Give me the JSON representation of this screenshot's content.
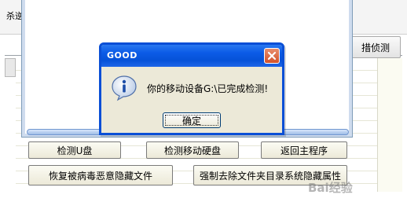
{
  "background": {
    "partial_title": "杀逆",
    "partial_tab_label": "措侦测"
  },
  "buttons": {
    "check_usb": "检测U盘",
    "check_hdd": "检测移动硬盘",
    "back_main": "返回主程序",
    "restore_hidden": "恢复被病毒恶意隐藏文件",
    "force_remove_hidden": "强制去除文件夹目录系统隐藏属性"
  },
  "dialog": {
    "title": "GOOD",
    "message": "你的移动设备G:\\已完成检测!",
    "ok_label": "确定",
    "icon": "info-icon"
  },
  "watermark": {
    "text": "Bai经验",
    "sub": "jingyan.baidu.com"
  },
  "colors": {
    "titlebar": "#0652d8",
    "close": "#d2512a",
    "dialog_bg": "#ece9d8",
    "button_bg": "#ece9d8"
  }
}
